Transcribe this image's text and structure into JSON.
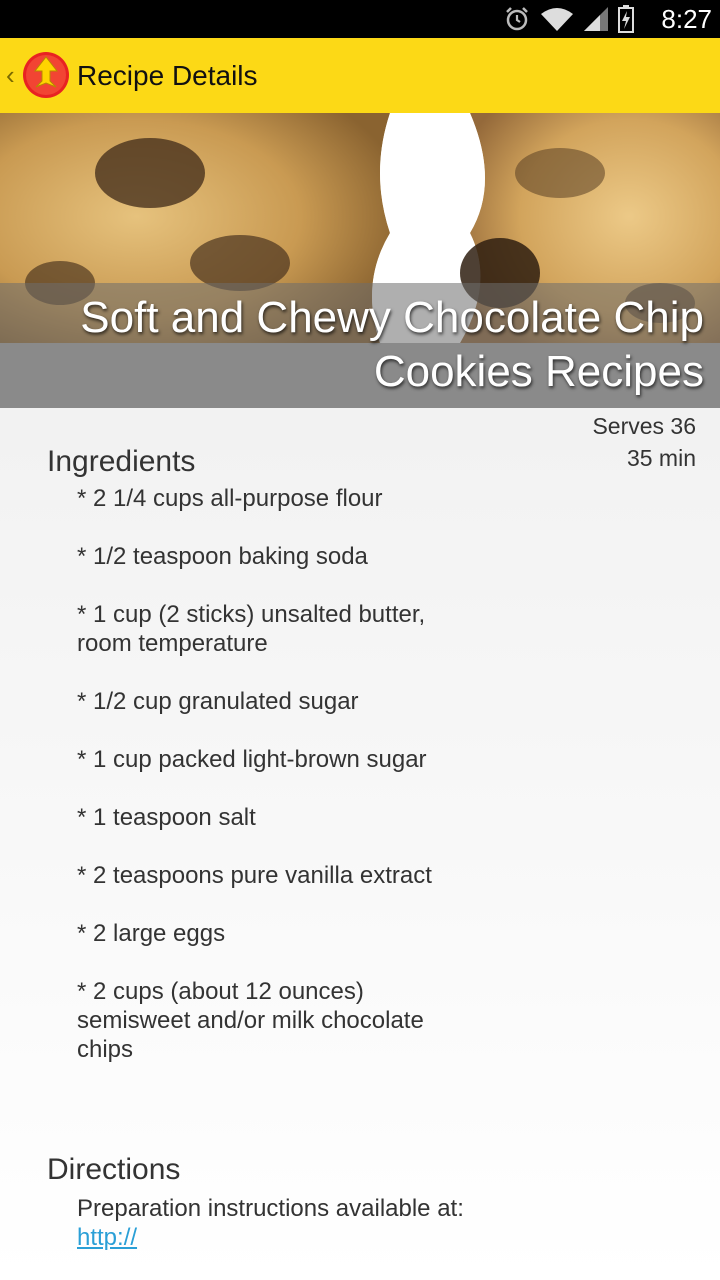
{
  "status_bar": {
    "time": "8:27",
    "icons": [
      "alarm-icon",
      "wifi-icon",
      "signal-icon",
      "battery-charging-icon"
    ]
  },
  "action_bar": {
    "title": "Recipe Details",
    "logo": "app-logo-icon",
    "background_color": "#fcd916"
  },
  "recipe": {
    "title": "Soft and Chewy Chocolate Chip Cookies Recipes",
    "serves": "Serves 36",
    "time": "35 min",
    "ingredients_heading": "Ingredients",
    "ingredients": [
      " * 2 1/4 cups all-purpose flour",
      " * 1/2 teaspoon baking soda",
      " * 1 cup (2 sticks) unsalted butter, room temperature",
      " * 1/2 cup granulated sugar",
      " * 1 cup packed light-brown sugar",
      " * 1 teaspoon salt",
      " * 2 teaspoons pure vanilla extract",
      " * 2 large eggs",
      " * 2 cups (about 12 ounces) semisweet and/or milk chocolate chips"
    ],
    "directions_heading": "Directions",
    "directions_text": "Preparation instructions available at:",
    "directions_link": "http://",
    "link_color": "#2a9fd6"
  }
}
